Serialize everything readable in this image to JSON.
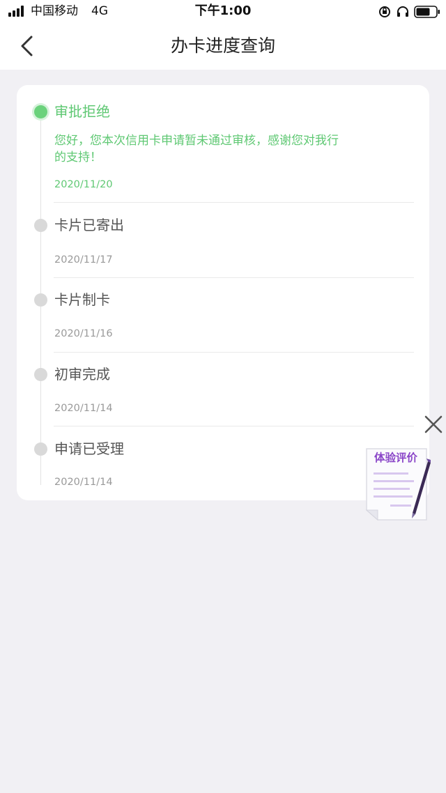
{
  "status_bar": {
    "carrier": "中国移动",
    "network": "4G",
    "time": "下午1:00",
    "icons": [
      "signal-icon",
      "orientation-lock-icon",
      "headphone-icon",
      "battery-icon"
    ]
  },
  "header": {
    "title": "办卡进度查询",
    "back_icon": "chevron-left-icon"
  },
  "timeline": {
    "steps": [
      {
        "title": "审批拒绝",
        "desc_line1": "您好，您本次信用卡申请暂未通过审核，感谢您对我行",
        "desc_line2": "的支持！",
        "date": "2020/11/20",
        "active": true
      },
      {
        "title": "卡片已寄出",
        "date": "2020/11/17",
        "active": false
      },
      {
        "title": "卡片制卡",
        "date": "2020/11/16",
        "active": false
      },
      {
        "title": "初审完成",
        "date": "2020/11/14",
        "active": false
      },
      {
        "title": "申请已受理",
        "date": "2020/11/14",
        "active": false
      }
    ]
  },
  "feedback": {
    "label": "体验评价",
    "close_icon": "close-icon"
  },
  "colors": {
    "accent_green": "#5fc873",
    "inactive_dot": "#d9d9d9",
    "feedback_purple": "#8a46c8",
    "page_background": "#f1f0f4"
  }
}
